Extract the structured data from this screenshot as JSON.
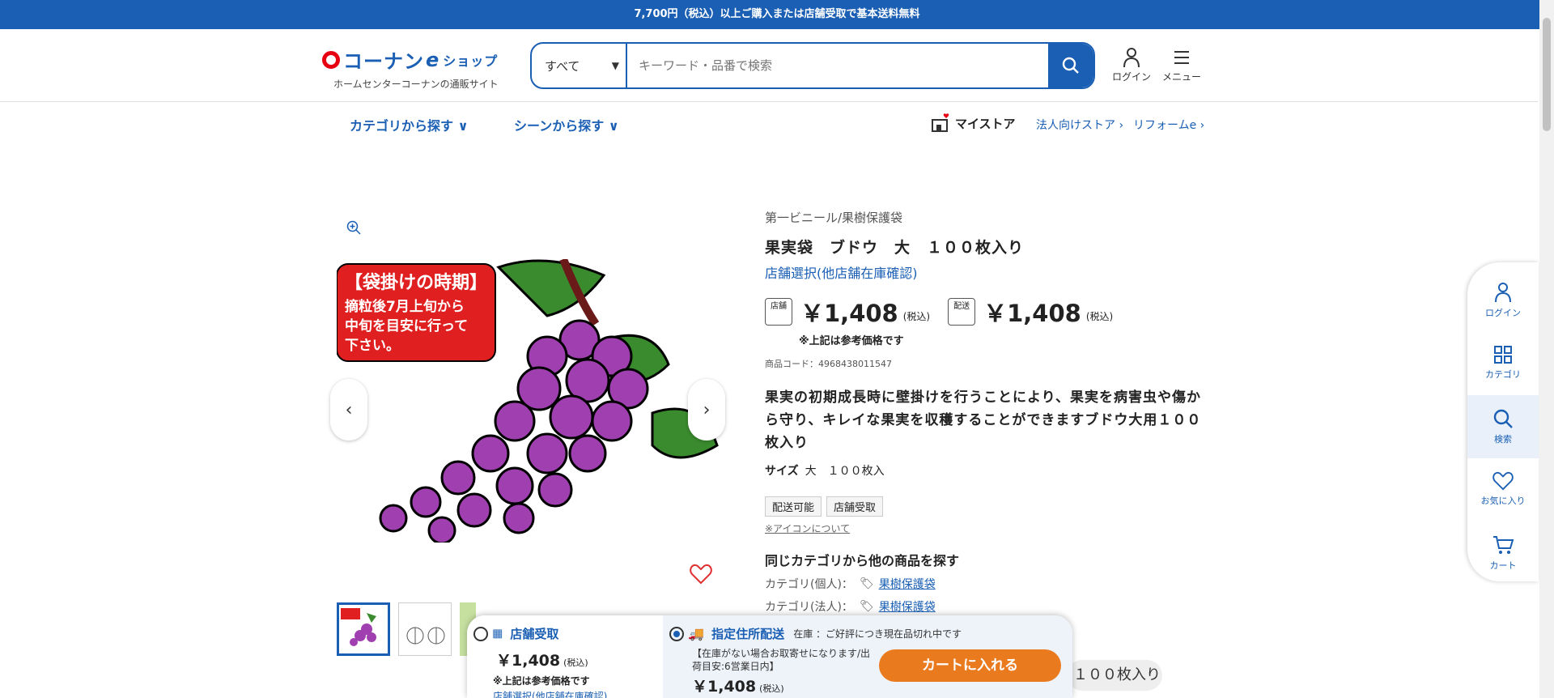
{
  "topbar": {
    "text": "7,700円（税込）以上ご購入または店舗受取で基本送料無料"
  },
  "logo": {
    "brand": "コーナン",
    "e": "e",
    "shop": "ショップ",
    "sub": "ホームセンターコーナンの通販サイト"
  },
  "search": {
    "category": "すべて",
    "placeholder": "キーワード・品番で検索"
  },
  "header": {
    "login": "ログイン",
    "menu": "メニュー"
  },
  "nav": {
    "category": "カテゴリから探す",
    "scene": "シーンから探す",
    "mystore": "マイストア",
    "corporate": "法人向けストア",
    "reform": "リフォームe"
  },
  "product": {
    "brand": "第一ビニール/果樹保護袋",
    "name": "果実袋　ブドウ　大　１００枚入り",
    "store_select": "店舗選択(他店舗在庫確認)",
    "store_icon_label": "店舗",
    "delivery_icon_label": "配送",
    "store_price": "￥1,408",
    "delivery_price": "￥1,408",
    "tax": "(税込)",
    "ref_note": "※上記は参考価格です",
    "code": "商品コード：4968438011547",
    "description": "果実の初期成長時に壁掛けを行うことにより、果実を病害虫や傷から守り、キレイな果実を収穫することができますブドウ大用１００枚入り",
    "size_label": "サイズ",
    "size_value": "大　１００枚入",
    "tags": [
      "配送可能",
      "店舗受取"
    ],
    "icon_note": "※アイコンについて",
    "same_category": "同じカテゴリから他の商品を探す",
    "cat_personal_label": "カテゴリ(個人)：",
    "cat_personal_link": "果樹保護袋",
    "cat_corporate_label": "カテゴリ(法人)：",
    "cat_corporate_link": "果樹保護袋"
  },
  "image_text": {
    "line1": "【袋掛けの時期】",
    "line2": "摘粒後7月上旬から",
    "line3": "中旬を目安に行って",
    "line4": "下さい。"
  },
  "sidebar": {
    "login": "ログイン",
    "category": "カテゴリ",
    "search": "検索",
    "favorite": "お気に入り",
    "cart": "カート"
  },
  "cart_panel": {
    "store_title": "店舗受取",
    "store_price": "￥1,408",
    "tax": "(税込)",
    "store_note": "※上記は参考価格です",
    "store_link": "店舗選択(他店舗在庫確認)",
    "delivery_title": "指定住所配送",
    "stock": "在庫 ：ご好評につき現在品切れ中です",
    "delivery_sub": "【在庫がない場合お取寄せになります/出荷目安:6営業日内】",
    "delivery_price": "￥1,408",
    "cart_button": "カートに入れる",
    "qty_pill": "１００枚入り"
  },
  "colors": {
    "primary": "#1a5fb4",
    "cart": "#ea7a1e",
    "logo_red": "#e60012"
  }
}
